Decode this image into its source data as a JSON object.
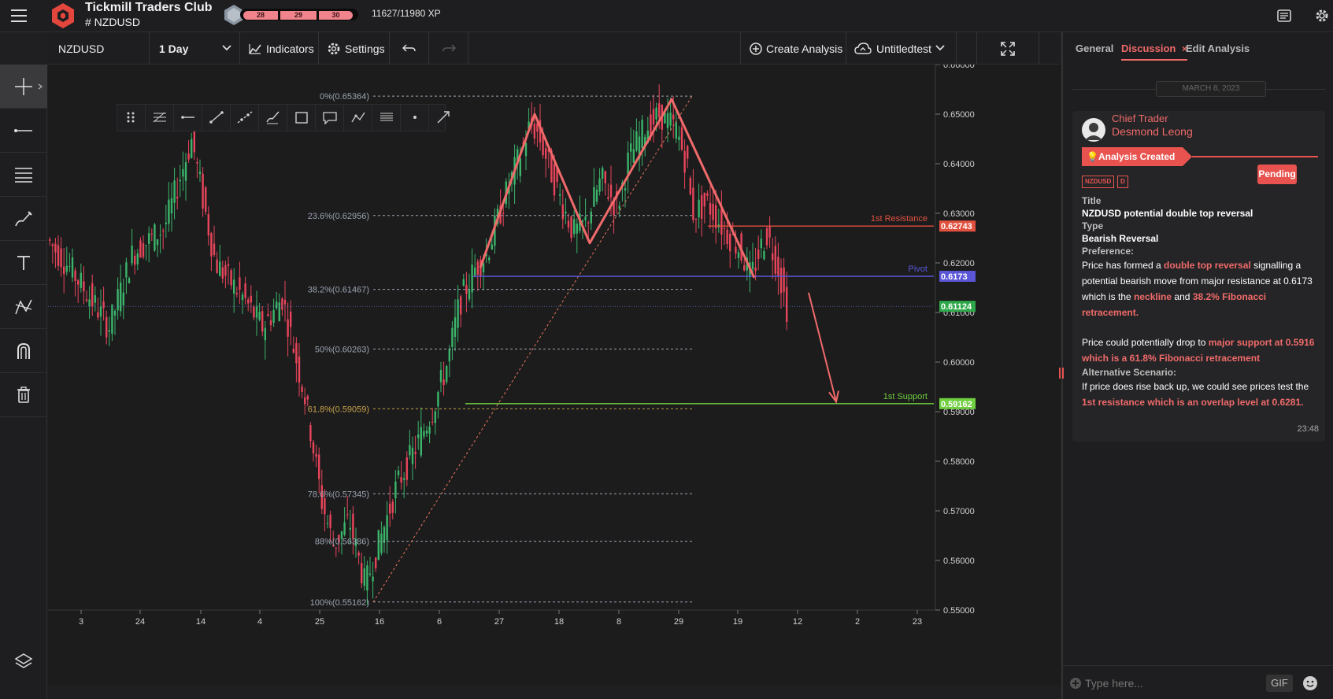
{
  "header": {
    "club_name": "Tickmill Traders Club",
    "room": "# NZDUSD",
    "xp_levels": [
      "28",
      "29",
      "30"
    ],
    "xp_text": "11627/11980 XP"
  },
  "toolbar": {
    "symbol": "NZDUSD",
    "interval": "1 Day",
    "indicators": "Indicators",
    "settings": "Settings",
    "create_analysis": "Create Analysis",
    "layout_name": "Untitledtest"
  },
  "drawing_toolbar": {
    "tools": [
      "drag-handle",
      "fib-retracement",
      "horizontal-ray",
      "trend-line",
      "extended-line",
      "brush",
      "rectangle",
      "callout",
      "path",
      "parallel-channel",
      "dot",
      "arrow-line"
    ]
  },
  "chart_data": {
    "type": "candlestick",
    "symbol": "NZDUSD",
    "interval": "1 Day",
    "ylim": [
      0.55,
      0.66
    ],
    "y_ticks": [
      "0.66000",
      "0.65000",
      "0.64000",
      "0.63000",
      "0.62000",
      "0.61000",
      "0.60000",
      "0.59000",
      "0.58000",
      "0.57000",
      "0.56000",
      "0.55000"
    ],
    "x_ticks": [
      "3",
      "24",
      "14",
      "4",
      "25",
      "16",
      "6",
      "27",
      "18",
      "8",
      "29",
      "19",
      "12",
      "2",
      "23"
    ],
    "fib_levels": [
      {
        "label": "0%(0.65364)",
        "value": 0.65364,
        "color": "#9aa3b0"
      },
      {
        "label": "23.6%(0.62956)",
        "value": 0.62956,
        "color": "#9aa3b0"
      },
      {
        "label": "38.2%(0.61467)",
        "value": 0.61467,
        "color": "#9aa3b0"
      },
      {
        "label": "50%(0.60263)",
        "value": 0.60263,
        "color": "#9aa3b0"
      },
      {
        "label": "61.8%(0.59059)",
        "value": 0.59059,
        "color": "#caa34a"
      },
      {
        "label": "78.6%(0.57345)",
        "value": 0.57345,
        "color": "#9aa3b0"
      },
      {
        "label": "88%(0.56386)",
        "value": 0.56386,
        "color": "#9aa3b0"
      },
      {
        "label": "100%(0.55162)",
        "value": 0.55162,
        "color": "#9aa3b0"
      }
    ],
    "horizontal_lines": [
      {
        "name": "1st Resistance",
        "value": 0.62743,
        "badge": "0.62743",
        "color": "#e2513f"
      },
      {
        "name": "Pivot",
        "value": 0.6173,
        "badge": "0.6173",
        "color": "#5a56d6"
      },
      {
        "name": "1st Support",
        "value": 0.59162,
        "badge": "0.59162",
        "color": "#6fcf3f"
      }
    ],
    "current_price": {
      "value": 0.61124,
      "badge": "0.61124",
      "color": "#2ea84a"
    },
    "double_top_pattern": [
      0.619,
      0.65,
      0.624,
      0.653,
      0.617
    ],
    "projection_arrow": {
      "from": 0.614,
      "to": 0.592
    }
  },
  "panel": {
    "tabs": {
      "general": "General",
      "discussion": "Discussion",
      "edit": "Edit Analysis"
    },
    "date": "MARCH 8, 2023",
    "author_role": "Chief Trader",
    "author_name": "Desmond Leong",
    "status_banner": "Analysis Created",
    "tags": [
      "NZDUSD",
      "D"
    ],
    "status_button": "Pending",
    "title_label": "Title",
    "title_value": "NZDUSD potential double top reversal",
    "type_label": "Type",
    "type_value": "Bearish Reversal",
    "pref_label": "Preference:",
    "p1_a": "Price has formed a ",
    "p1_b": "double top reversal",
    "p1_c": " signalling a potential bearish move from major resistance at 0.6173 which is the ",
    "p1_d": "neckline",
    "p1_e": " and ",
    "p1_f": "38.2% Fibonacci retracement.",
    "p2_a": "Price could potentially drop to ",
    "p2_b": "major support at 0.5916 which is a 61.8% Fibonacci retracement",
    "alt_label": "Alternative Scenario:",
    "p3_a": "If price does rise back up, we could see prices test the ",
    "p3_b": "1st resistance which is an overlap level at 0.6281.",
    "time": "23:48",
    "input_placeholder": "Type here...",
    "gif_label": "GIF"
  }
}
